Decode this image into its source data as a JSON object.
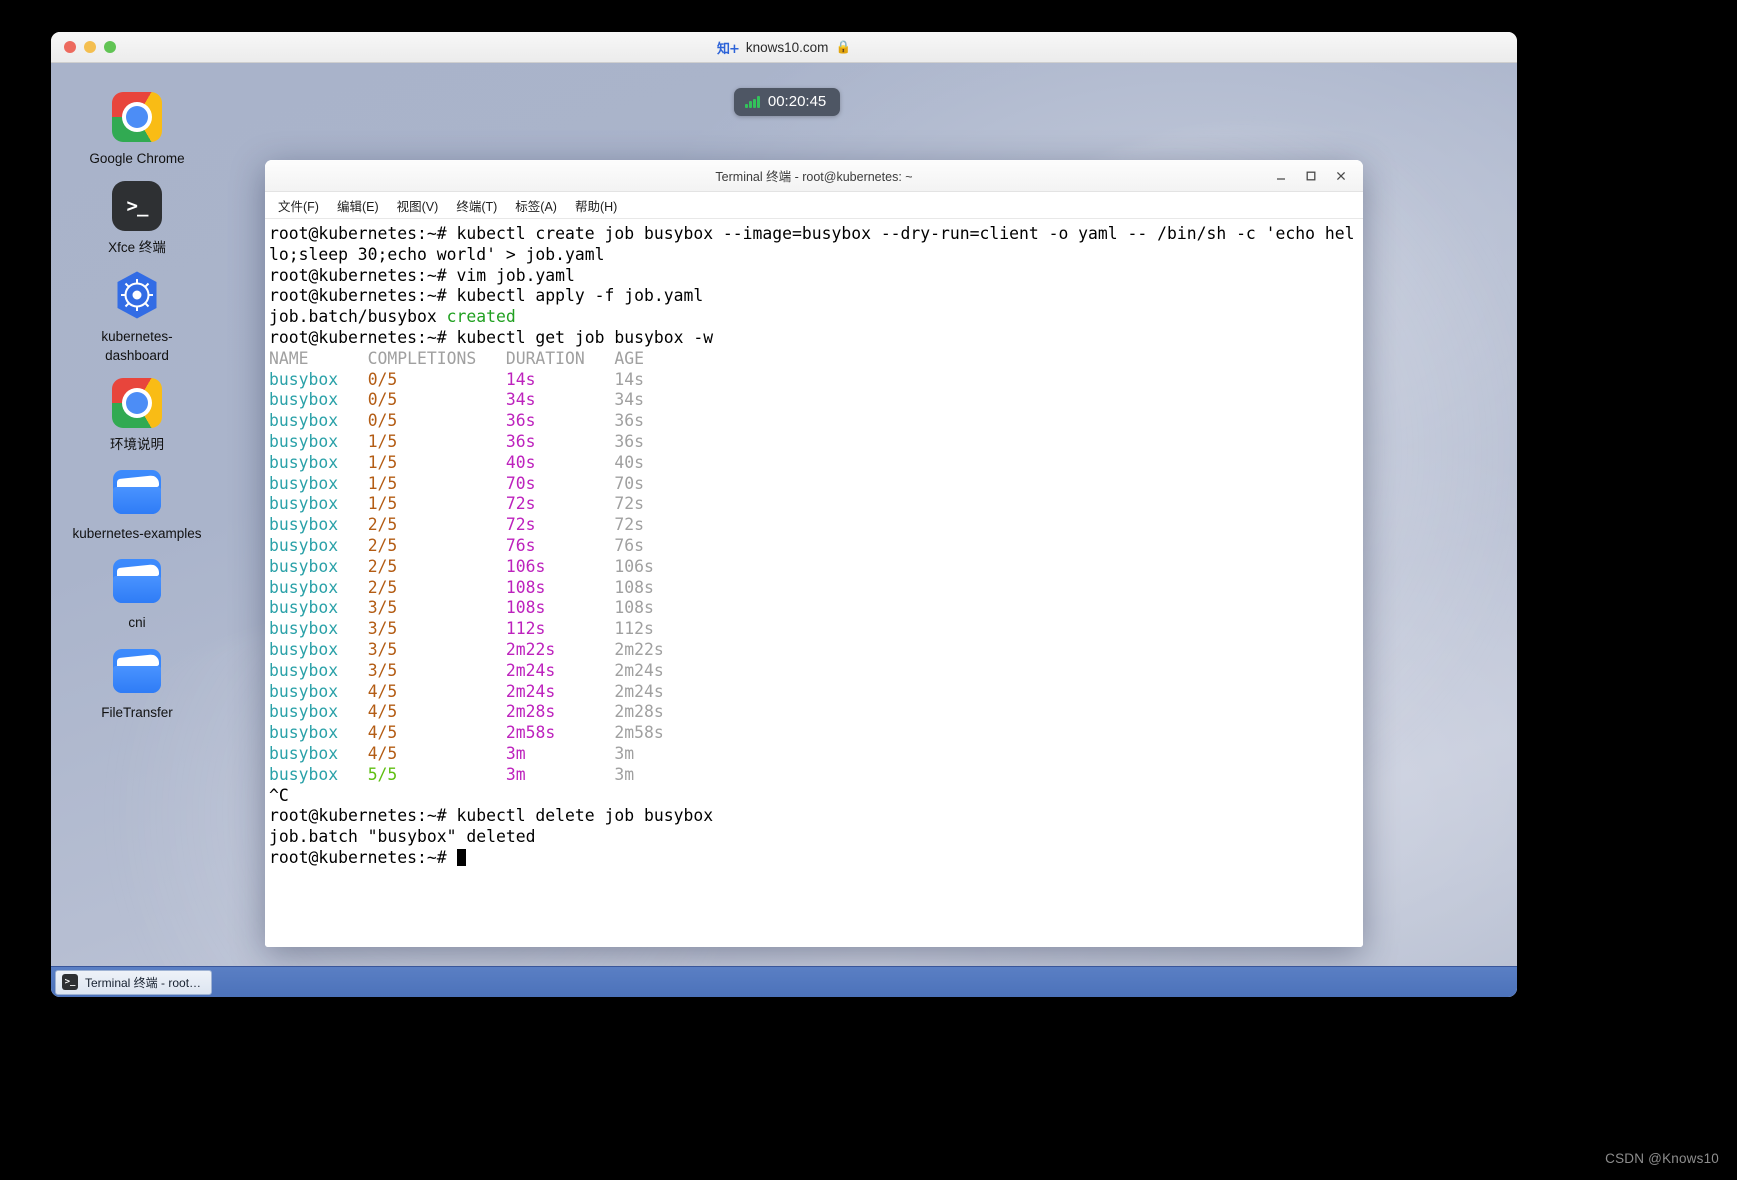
{
  "browser": {
    "favicon_text": "知+",
    "url": "knows10.com",
    "lock_icon": "🔒",
    "traffic_lights": [
      "close",
      "minimize",
      "zoom"
    ]
  },
  "timer": {
    "label": "00:20:45",
    "signal_icon": "signal-bars-icon"
  },
  "desktop": {
    "icons": [
      {
        "name": "google-chrome",
        "label": "Google Chrome",
        "icon": "chrome-icon"
      },
      {
        "name": "xfce-terminal",
        "label": "Xfce 终端",
        "icon": "terminal-icon",
        "glyph": ">_"
      },
      {
        "name": "kubernetes-dashboard",
        "label": "kubernetes-dashboard",
        "icon": "kubernetes-helm-icon"
      },
      {
        "name": "environment-notes",
        "label": "环境说明",
        "icon": "chrome-icon"
      },
      {
        "name": "kubernetes-examples",
        "label": "kubernetes-examples",
        "icon": "folder-icon"
      },
      {
        "name": "cni",
        "label": "cni",
        "icon": "folder-icon"
      },
      {
        "name": "file-transfer",
        "label": "FileTransfer",
        "icon": "folder-icon"
      }
    ]
  },
  "terminal": {
    "title": "Terminal 终端 - root@kubernetes: ~",
    "window_buttons": {
      "minimize": "minimize-icon",
      "maximize": "maximize-icon",
      "close": "close-icon"
    },
    "menu": [
      {
        "name": "file",
        "label": "文件(F)"
      },
      {
        "name": "edit",
        "label": "编辑(E)"
      },
      {
        "name": "view",
        "label": "视图(V)"
      },
      {
        "name": "terminal",
        "label": "终端(T)"
      },
      {
        "name": "tabs",
        "label": "标签(A)"
      },
      {
        "name": "help",
        "label": "帮助(H)"
      }
    ],
    "lines": [
      [
        {
          "t": "root@kubernetes:~# kubectl create job busybox --image=busybox --dry-run=client -o yaml -- /bin/sh -c 'echo hel",
          "c": "default"
        }
      ],
      [
        {
          "t": "lo;sleep 30;echo world' > job.yaml",
          "c": "default"
        }
      ],
      [
        {
          "t": "root@kubernetes:~# vim job.yaml",
          "c": "default"
        }
      ],
      [
        {
          "t": "root@kubernetes:~# kubectl apply -f job.yaml",
          "c": "default"
        }
      ],
      [
        {
          "t": "job.batch/busybox ",
          "c": "default"
        },
        {
          "t": "created",
          "c": "green"
        }
      ],
      [
        {
          "t": "root@kubernetes:~# kubectl get job busybox -w",
          "c": "default"
        }
      ],
      [
        {
          "t": "NAME      COMPLETIONS   DURATION   AGE",
          "c": "gray"
        }
      ],
      [
        {
          "t": "busybox   ",
          "c": "cyan"
        },
        {
          "t": "0/5",
          "c": "orange"
        },
        {
          "t": "           ",
          "c": "default"
        },
        {
          "t": "14s",
          "c": "magenta"
        },
        {
          "t": "        ",
          "c": "default"
        },
        {
          "t": "14s",
          "c": "gray"
        }
      ],
      [
        {
          "t": "busybox   ",
          "c": "cyan"
        },
        {
          "t": "0/5",
          "c": "orange"
        },
        {
          "t": "           ",
          "c": "default"
        },
        {
          "t": "34s",
          "c": "magenta"
        },
        {
          "t": "        ",
          "c": "default"
        },
        {
          "t": "34s",
          "c": "gray"
        }
      ],
      [
        {
          "t": "busybox   ",
          "c": "cyan"
        },
        {
          "t": "0/5",
          "c": "orange"
        },
        {
          "t": "           ",
          "c": "default"
        },
        {
          "t": "36s",
          "c": "magenta"
        },
        {
          "t": "        ",
          "c": "default"
        },
        {
          "t": "36s",
          "c": "gray"
        }
      ],
      [
        {
          "t": "busybox   ",
          "c": "cyan"
        },
        {
          "t": "1/5",
          "c": "orange"
        },
        {
          "t": "           ",
          "c": "default"
        },
        {
          "t": "36s",
          "c": "magenta"
        },
        {
          "t": "        ",
          "c": "default"
        },
        {
          "t": "36s",
          "c": "gray"
        }
      ],
      [
        {
          "t": "busybox   ",
          "c": "cyan"
        },
        {
          "t": "1/5",
          "c": "orange"
        },
        {
          "t": "           ",
          "c": "default"
        },
        {
          "t": "40s",
          "c": "magenta"
        },
        {
          "t": "        ",
          "c": "default"
        },
        {
          "t": "40s",
          "c": "gray"
        }
      ],
      [
        {
          "t": "busybox   ",
          "c": "cyan"
        },
        {
          "t": "1/5",
          "c": "orange"
        },
        {
          "t": "           ",
          "c": "default"
        },
        {
          "t": "70s",
          "c": "magenta"
        },
        {
          "t": "        ",
          "c": "default"
        },
        {
          "t": "70s",
          "c": "gray"
        }
      ],
      [
        {
          "t": "busybox   ",
          "c": "cyan"
        },
        {
          "t": "1/5",
          "c": "orange"
        },
        {
          "t": "           ",
          "c": "default"
        },
        {
          "t": "72s",
          "c": "magenta"
        },
        {
          "t": "        ",
          "c": "default"
        },
        {
          "t": "72s",
          "c": "gray"
        }
      ],
      [
        {
          "t": "busybox   ",
          "c": "cyan"
        },
        {
          "t": "2/5",
          "c": "orange"
        },
        {
          "t": "           ",
          "c": "default"
        },
        {
          "t": "72s",
          "c": "magenta"
        },
        {
          "t": "        ",
          "c": "default"
        },
        {
          "t": "72s",
          "c": "gray"
        }
      ],
      [
        {
          "t": "busybox   ",
          "c": "cyan"
        },
        {
          "t": "2/5",
          "c": "orange"
        },
        {
          "t": "           ",
          "c": "default"
        },
        {
          "t": "76s",
          "c": "magenta"
        },
        {
          "t": "        ",
          "c": "default"
        },
        {
          "t": "76s",
          "c": "gray"
        }
      ],
      [
        {
          "t": "busybox   ",
          "c": "cyan"
        },
        {
          "t": "2/5",
          "c": "orange"
        },
        {
          "t": "           ",
          "c": "default"
        },
        {
          "t": "106s",
          "c": "magenta"
        },
        {
          "t": "       ",
          "c": "default"
        },
        {
          "t": "106s",
          "c": "gray"
        }
      ],
      [
        {
          "t": "busybox   ",
          "c": "cyan"
        },
        {
          "t": "2/5",
          "c": "orange"
        },
        {
          "t": "           ",
          "c": "default"
        },
        {
          "t": "108s",
          "c": "magenta"
        },
        {
          "t": "       ",
          "c": "default"
        },
        {
          "t": "108s",
          "c": "gray"
        }
      ],
      [
        {
          "t": "busybox   ",
          "c": "cyan"
        },
        {
          "t": "3/5",
          "c": "orange"
        },
        {
          "t": "           ",
          "c": "default"
        },
        {
          "t": "108s",
          "c": "magenta"
        },
        {
          "t": "       ",
          "c": "default"
        },
        {
          "t": "108s",
          "c": "gray"
        }
      ],
      [
        {
          "t": "busybox   ",
          "c": "cyan"
        },
        {
          "t": "3/5",
          "c": "orange"
        },
        {
          "t": "           ",
          "c": "default"
        },
        {
          "t": "112s",
          "c": "magenta"
        },
        {
          "t": "       ",
          "c": "default"
        },
        {
          "t": "112s",
          "c": "gray"
        }
      ],
      [
        {
          "t": "busybox   ",
          "c": "cyan"
        },
        {
          "t": "3/5",
          "c": "orange"
        },
        {
          "t": "           ",
          "c": "default"
        },
        {
          "t": "2m22s",
          "c": "magenta"
        },
        {
          "t": "      ",
          "c": "default"
        },
        {
          "t": "2m22s",
          "c": "gray"
        }
      ],
      [
        {
          "t": "busybox   ",
          "c": "cyan"
        },
        {
          "t": "3/5",
          "c": "orange"
        },
        {
          "t": "           ",
          "c": "default"
        },
        {
          "t": "2m24s",
          "c": "magenta"
        },
        {
          "t": "      ",
          "c": "default"
        },
        {
          "t": "2m24s",
          "c": "gray"
        }
      ],
      [
        {
          "t": "busybox   ",
          "c": "cyan"
        },
        {
          "t": "4/5",
          "c": "orange"
        },
        {
          "t": "           ",
          "c": "default"
        },
        {
          "t": "2m24s",
          "c": "magenta"
        },
        {
          "t": "      ",
          "c": "default"
        },
        {
          "t": "2m24s",
          "c": "gray"
        }
      ],
      [
        {
          "t": "busybox   ",
          "c": "cyan"
        },
        {
          "t": "4/5",
          "c": "orange"
        },
        {
          "t": "           ",
          "c": "default"
        },
        {
          "t": "2m28s",
          "c": "magenta"
        },
        {
          "t": "      ",
          "c": "default"
        },
        {
          "t": "2m28s",
          "c": "gray"
        }
      ],
      [
        {
          "t": "busybox   ",
          "c": "cyan"
        },
        {
          "t": "4/5",
          "c": "orange"
        },
        {
          "t": "           ",
          "c": "default"
        },
        {
          "t": "2m58s",
          "c": "magenta"
        },
        {
          "t": "      ",
          "c": "default"
        },
        {
          "t": "2m58s",
          "c": "gray"
        }
      ],
      [
        {
          "t": "busybox   ",
          "c": "cyan"
        },
        {
          "t": "4/5",
          "c": "orange"
        },
        {
          "t": "           ",
          "c": "default"
        },
        {
          "t": "3m",
          "c": "magenta"
        },
        {
          "t": "         ",
          "c": "default"
        },
        {
          "t": "3m",
          "c": "gray"
        }
      ],
      [
        {
          "t": "busybox   ",
          "c": "cyan"
        },
        {
          "t": "5/5",
          "c": "lime"
        },
        {
          "t": "           ",
          "c": "default"
        },
        {
          "t": "3m",
          "c": "magenta"
        },
        {
          "t": "         ",
          "c": "default"
        },
        {
          "t": "3m",
          "c": "gray"
        }
      ],
      [
        {
          "t": "^C",
          "c": "default"
        }
      ],
      [
        {
          "t": "root@kubernetes:~# kubectl delete job busybox",
          "c": "default"
        }
      ],
      [
        {
          "t": "job.batch \"busybox\" deleted",
          "c": "default"
        }
      ],
      [
        {
          "t": "root@kubernetes:~# ",
          "c": "default"
        },
        {
          "t": "",
          "c": "cursor"
        }
      ]
    ],
    "table": {
      "headers": [
        "NAME",
        "COMPLETIONS",
        "DURATION",
        "AGE"
      ],
      "rows": [
        [
          "busybox",
          "0/5",
          "14s",
          "14s"
        ],
        [
          "busybox",
          "0/5",
          "34s",
          "34s"
        ],
        [
          "busybox",
          "0/5",
          "36s",
          "36s"
        ],
        [
          "busybox",
          "1/5",
          "36s",
          "36s"
        ],
        [
          "busybox",
          "1/5",
          "40s",
          "40s"
        ],
        [
          "busybox",
          "1/5",
          "70s",
          "70s"
        ],
        [
          "busybox",
          "1/5",
          "72s",
          "72s"
        ],
        [
          "busybox",
          "2/5",
          "72s",
          "72s"
        ],
        [
          "busybox",
          "2/5",
          "76s",
          "76s"
        ],
        [
          "busybox",
          "2/5",
          "106s",
          "106s"
        ],
        [
          "busybox",
          "2/5",
          "108s",
          "108s"
        ],
        [
          "busybox",
          "3/5",
          "108s",
          "108s"
        ],
        [
          "busybox",
          "3/5",
          "112s",
          "112s"
        ],
        [
          "busybox",
          "3/5",
          "2m22s",
          "2m22s"
        ],
        [
          "busybox",
          "3/5",
          "2m24s",
          "2m24s"
        ],
        [
          "busybox",
          "4/5",
          "2m24s",
          "2m24s"
        ],
        [
          "busybox",
          "4/5",
          "2m28s",
          "2m28s"
        ],
        [
          "busybox",
          "4/5",
          "2m58s",
          "2m58s"
        ],
        [
          "busybox",
          "4/5",
          "3m",
          "3m"
        ],
        [
          "busybox",
          "5/5",
          "3m",
          "3m"
        ]
      ]
    }
  },
  "taskbar": {
    "item_label": "Terminal 终端 - root…",
    "item_icon": ">_"
  },
  "watermark": "CSDN @Knows10",
  "colors": {
    "terminal_green": "#20a020",
    "terminal_cyan": "#2aa1a8",
    "terminal_orange": "#b35c14",
    "terminal_magenta": "#bd22bd",
    "terminal_gray": "#a0a0a0",
    "terminal_lime": "#5fbf11",
    "taskbar_blue": "#4c72ba",
    "timer_pill": "#4e5664"
  }
}
